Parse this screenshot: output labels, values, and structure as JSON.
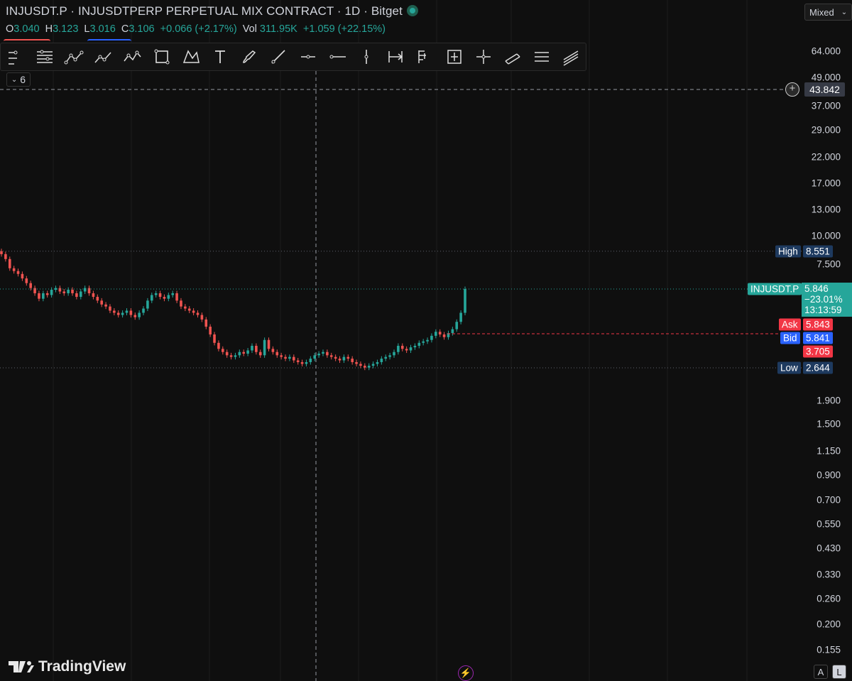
{
  "header": {
    "title": "INJUSDT.P · INJUSDTPERP PERPETUAL MIX CONTRACT · 1D · Bitget",
    "ohlc": {
      "o_label": "O",
      "o": "3.040",
      "h_label": "H",
      "h": "3.123",
      "l_label": "L",
      "l": "3.016",
      "c_label": "C",
      "c": "3.106",
      "change": "+0.066 (+2.17%)",
      "vol_label": "Vol",
      "vol": "311.95K",
      "vol_change": "+1.059 (+22.15%)"
    }
  },
  "scale_mode": "Mixed",
  "indicator_count": "6",
  "toolbar": {
    "tools": [
      "trend-lines-icon",
      "fib-icon",
      "abcd-pattern-icon",
      "polyline-icon",
      "wxy-pattern-icon",
      "rectangle-icon",
      "xabcd-pattern-icon",
      "text-icon",
      "brush-icon",
      "ray-icon",
      "horizontal-ray-icon",
      "horizontal-line-icon",
      "vertical-line-icon",
      "date-range-icon",
      "price-range-icon",
      "date-price-range-icon",
      "cross-line-icon",
      "parallel-channel-icon",
      "pitchfan-icon",
      "regression-icon"
    ]
  },
  "price_axis": {
    "labels": [
      "64.000",
      "49.000",
      "37.000",
      "29.000",
      "22.000",
      "17.000",
      "13.000",
      "10.000",
      "7.500",
      "1.900",
      "1.500",
      "1.150",
      "0.900",
      "0.700",
      "0.550",
      "0.430",
      "0.330",
      "0.260",
      "0.200",
      "0.155"
    ]
  },
  "crosshair_price": "43.842",
  "markers": {
    "high_label": "High",
    "high_value": "8.551",
    "low_label": "Low",
    "low_value": "2.644",
    "symbol": "INJUSDT.P",
    "last_price": "5.846",
    "last_change": "−23.01%",
    "countdown": "13:13:59",
    "ask_label": "Ask",
    "ask_value": "5.843",
    "bid_label": "Bid",
    "bid_value": "5.841",
    "extra_value": "3.705"
  },
  "colors": {
    "up": "#26a69a",
    "down": "#ef5350",
    "background": "#0f0f0f",
    "ask": "#f23645",
    "bid": "#2962ff",
    "marker_bg": "#1e3a5f"
  },
  "footer": {
    "brand": "TradingView",
    "auto_label": "A",
    "log_label": "L"
  },
  "chart_data": {
    "type": "candlestick",
    "y_scale": "log",
    "ylim": [
      0.14,
      80
    ],
    "series": [
      {
        "name": "INJUSDT.P",
        "close": [
          8.3,
          7.9,
          7.2,
          7.0,
          6.8,
          6.5,
          6.2,
          5.9,
          5.6,
          5.3,
          5.6,
          5.5,
          5.8,
          5.9,
          5.7,
          5.6,
          5.8,
          5.6,
          5.4,
          5.7,
          5.9,
          5.6,
          5.4,
          5.2,
          5.0,
          4.9,
          4.7,
          4.6,
          4.5,
          4.6,
          4.7,
          4.5,
          4.4,
          4.6,
          4.8,
          5.2,
          5.5,
          5.6,
          5.4,
          5.3,
          5.5,
          5.6,
          5.2,
          4.9,
          4.8,
          4.7,
          4.6,
          4.5,
          4.3,
          4.0,
          3.7,
          3.4,
          3.2,
          3.1,
          3.0,
          2.95,
          3.0,
          3.1,
          3.05,
          3.15,
          3.3,
          3.1,
          3.0,
          3.5,
          3.2,
          3.1,
          3.0,
          2.95,
          2.9,
          2.95,
          2.85,
          2.8,
          2.75,
          2.8,
          2.9,
          3.0,
          3.05,
          3.1,
          3.0,
          2.95,
          2.9,
          2.85,
          2.95,
          2.9,
          2.8,
          2.75,
          2.7,
          2.65,
          2.7,
          2.75,
          2.8,
          2.9,
          2.95,
          3.0,
          3.1,
          3.3,
          3.2,
          3.15,
          3.25,
          3.3,
          3.4,
          3.45,
          3.5,
          3.65,
          3.8,
          3.7,
          3.6,
          3.75,
          3.9,
          4.2,
          4.6,
          5.846
        ]
      }
    ]
  }
}
